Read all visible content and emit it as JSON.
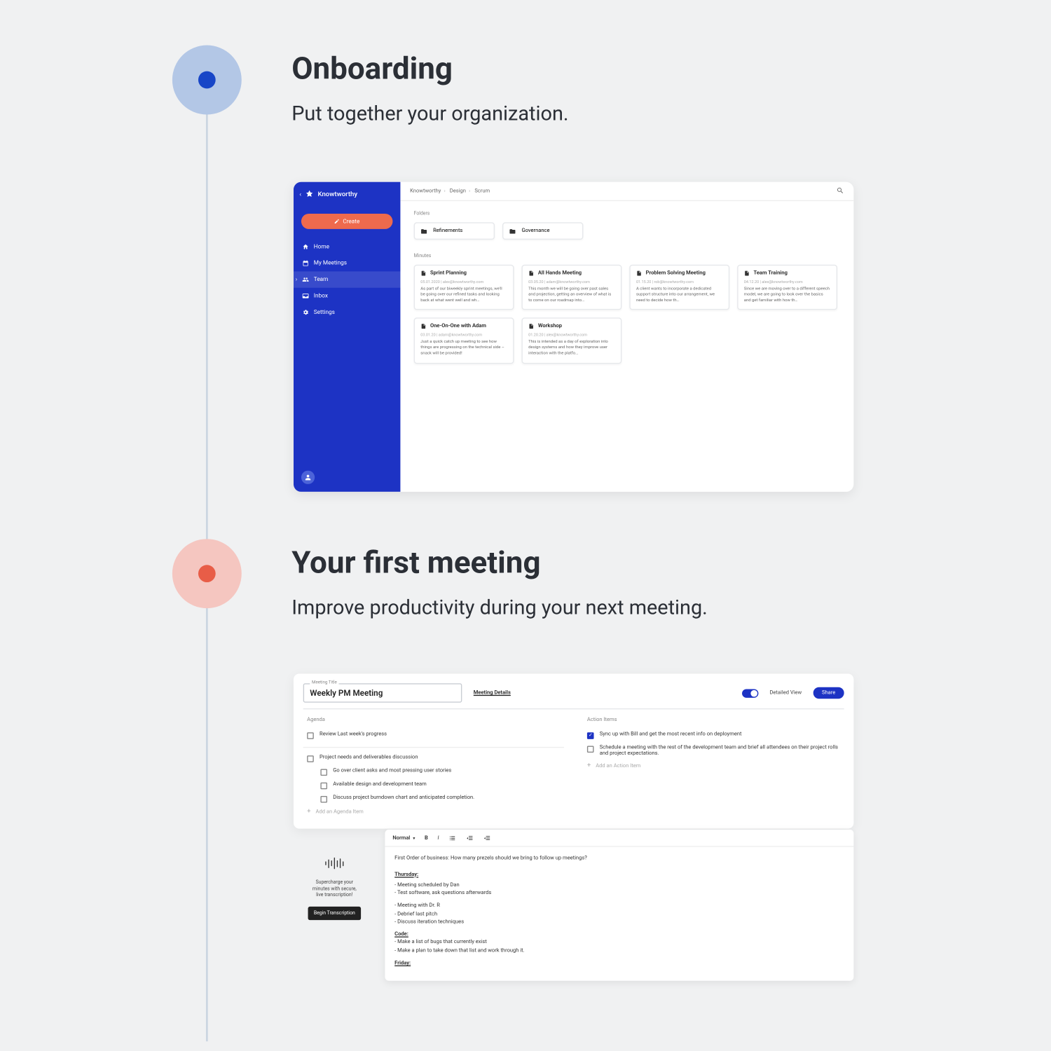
{
  "s1": {
    "title": "Onboarding",
    "sub": "Put together your organization."
  },
  "s2": {
    "title": "Your first meeting",
    "sub": "Improve productivity during your next meeting."
  },
  "app": {
    "brand": "Knowtworthy",
    "create": "Create",
    "nav": {
      "home": "Home",
      "meetings": "My Meetings",
      "team": "Team",
      "inbox": "Inbox",
      "settings": "Settings"
    },
    "crumbs": [
      "Knowtworthy",
      "Design",
      "Scrum"
    ],
    "folders_label": "Folders",
    "folders": [
      "Refinements",
      "Governance"
    ],
    "minutes_label": "Minutes",
    "cards": [
      {
        "t": "Sprint Planning",
        "m": "05.01.2020 | alex@knowtworthy.com",
        "d": "As part of our biweekly sprint meetings, we'll be going over our refined tasks and looking back at what went well and wh…"
      },
      {
        "t": "All Hands Meeting",
        "m": "03.05.20 | adam@knowtworthy.com",
        "d": "This month we will be going over past sales and projection, getting an overview of what is to come on our roadmap into…"
      },
      {
        "t": "Problem Solving Meeting",
        "m": "01.15.20 | rob@knowtworthy.com",
        "d": "A client wants to incorporate a dedicated support structure into our arrangement, we need to decide how th…"
      },
      {
        "t": "Team Training",
        "m": "04.12.20 | alex@knowtworthy.com",
        "d": "Since we are moving over to a different speech model, we are going to look over the basics and get familiar with how th…"
      },
      {
        "t": "One-On-One with Adam",
        "m": "03.01.20 | adam@knowtworthy.com",
        "d": "Just a quick catch up meeting to see how things are progressing on the technical side – snack will be provided!"
      },
      {
        "t": "Workshop",
        "m": "01.20.20 | alex@knowtworthy.com",
        "d": "This is intended as a day of exploration into design systems and how they improve user interaction with the platfo…"
      }
    ]
  },
  "meeting": {
    "title_label": "Meeting Title",
    "title": "Weekly PM Meeting",
    "details": "Meeting Details",
    "detailed": "Detailed View",
    "share": "Share",
    "agenda_h": "Agenda",
    "actions_h": "Action Items",
    "agenda1": "Review Last week's progress",
    "agenda2": "Project needs and deliverables discussion",
    "agenda2a": "Go over client asks and most pressing user stories",
    "agenda2b": "Available design and development team",
    "agenda2c": "Discuss project burndown chart and anticipated completion.",
    "add_agenda": "Add an Agenda Item",
    "action1": "Sync up with Bill and get the most recent info on deployment",
    "action2": "Schedule a meeting with the rest of the development team and brief all attendees on their project rolls and project expectations.",
    "add_action": "Add an Action Item"
  },
  "transc": {
    "l1": "Supercharge your",
    "l2": "minutes with secure,",
    "l3": "live transcription!",
    "btn": "Begin Transcription"
  },
  "editor": {
    "style": "Normal",
    "line1": "First Order of business: How many prezels should we bring to follow up meetings?",
    "h1": "Thursday:",
    "b1a": "- Meeting scheduled by Dan",
    "b1b": "- Test software, ask questions afterwards",
    "b2a": "- Meeting with Dr. R",
    "b2b": "- Debrief last pitch",
    "b2c": "- Discuss iteration techniques",
    "h2": "Code:",
    "c1": "- Make a list of bugs that currently exist",
    "c2": "- Make a plan to take down that list and work through it.",
    "h3": "Friday:"
  }
}
